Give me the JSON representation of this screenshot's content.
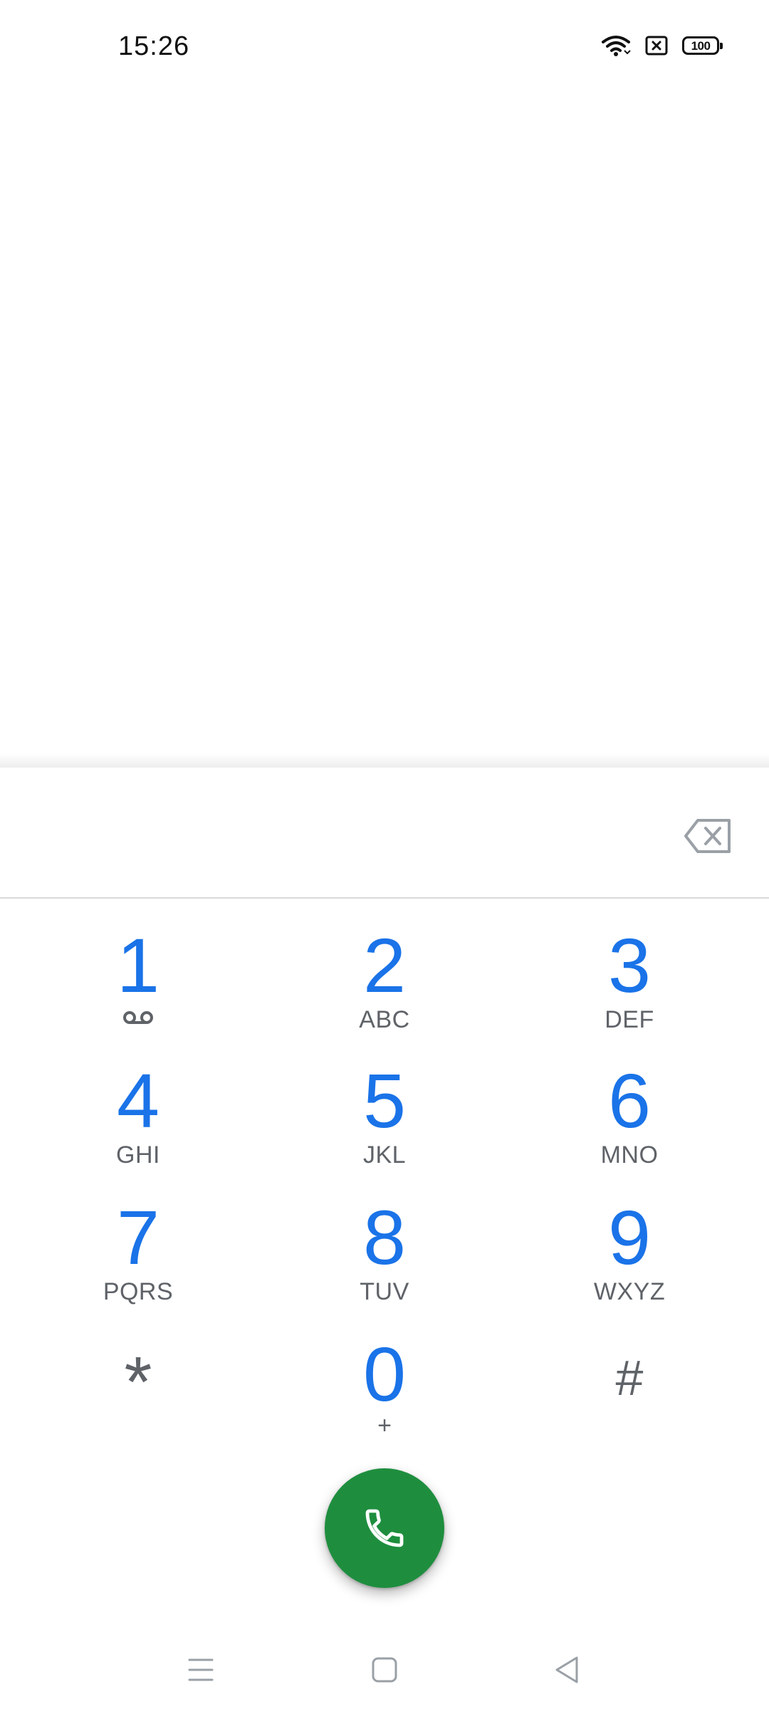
{
  "status_bar": {
    "time": "15:26",
    "battery_level": "100",
    "icons": [
      "wifi-icon",
      "sim-error-icon",
      "battery-icon"
    ]
  },
  "dialer": {
    "digits": "",
    "keys": [
      {
        "digit": "1",
        "letters": "",
        "extra_icon": "voicemail-icon"
      },
      {
        "digit": "2",
        "letters": "ABC"
      },
      {
        "digit": "3",
        "letters": "DEF"
      },
      {
        "digit": "4",
        "letters": "GHI"
      },
      {
        "digit": "5",
        "letters": "JKL"
      },
      {
        "digit": "6",
        "letters": "MNO"
      },
      {
        "digit": "7",
        "letters": "PQRS"
      },
      {
        "digit": "8",
        "letters": "TUV"
      },
      {
        "digit": "9",
        "letters": "WXYZ"
      },
      {
        "digit": "*",
        "letters": ""
      },
      {
        "digit": "0",
        "letters": "+"
      },
      {
        "digit": "#",
        "letters": ""
      }
    ],
    "call_icon": "phone-icon",
    "backspace_icon": "backspace-icon"
  },
  "nav_bar": {
    "buttons": [
      "menu-icon",
      "home-icon",
      "back-icon"
    ]
  },
  "colors": {
    "digit": "#1a73e8",
    "letters": "#5f6368",
    "call_button": "#1e8e3e",
    "background": "#ffffff"
  }
}
